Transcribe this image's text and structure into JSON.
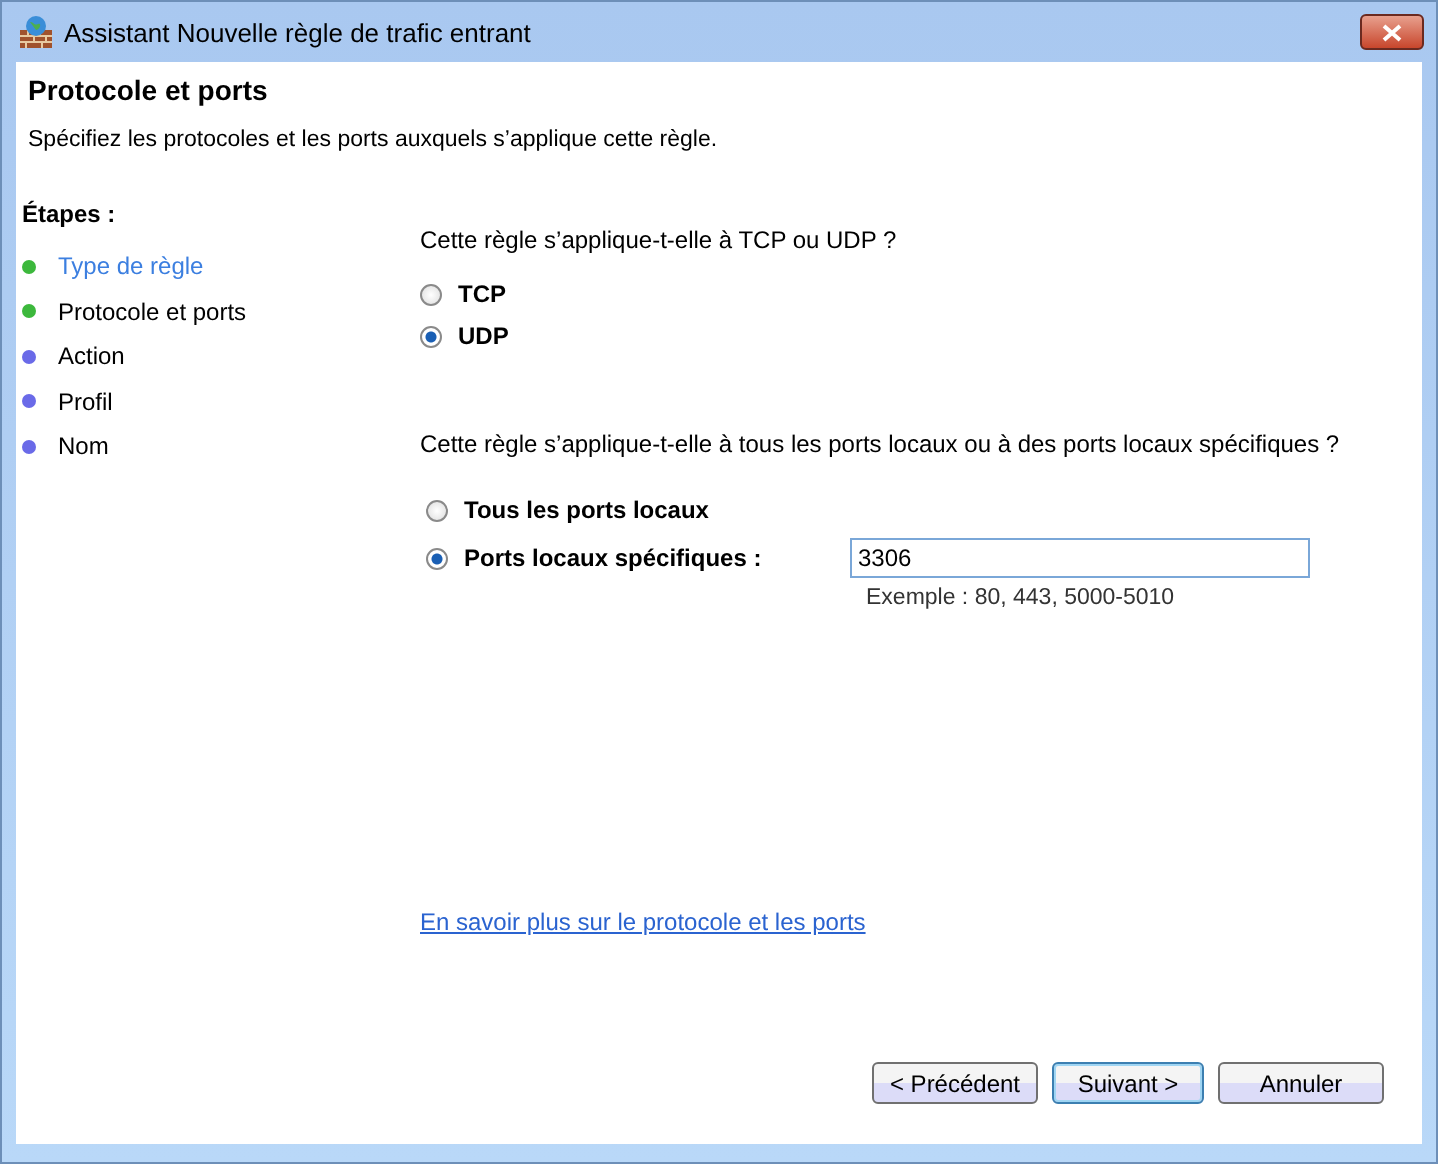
{
  "window": {
    "title": "Assistant Nouvelle règle de trafic entrant"
  },
  "header": {
    "title": "Protocole et ports",
    "subtitle": "Spécifiez les protocoles et les ports auxquels s’applique cette règle."
  },
  "steps": {
    "heading": "Étapes :",
    "items": [
      {
        "label": "Type de règle",
        "color": "#3cb83c",
        "link": true
      },
      {
        "label": "Protocole et ports",
        "color": "#3cb83c",
        "link": false
      },
      {
        "label": "Action",
        "color": "#6a6ae8",
        "link": false
      },
      {
        "label": "Profil",
        "color": "#6a6ae8",
        "link": false
      },
      {
        "label": "Nom",
        "color": "#6a6ae8",
        "link": false
      }
    ]
  },
  "protocol": {
    "question": "Cette règle s’applique-t-elle à TCP ou UDP ?",
    "options": [
      {
        "label": "TCP",
        "selected": false
      },
      {
        "label": "UDP",
        "selected": true
      }
    ]
  },
  "ports": {
    "question": "Cette règle s’applique-t-elle à tous les ports locaux ou à des ports locaux spécifiques ?",
    "options": [
      {
        "label": "Tous les ports locaux",
        "selected": false
      },
      {
        "label": "Ports locaux spécifiques :",
        "selected": true
      }
    ],
    "value": "3306",
    "example": "Exemple : 80, 443, 5000-5010"
  },
  "link": "En savoir plus sur le protocole et les ports",
  "buttons": [
    {
      "label": "< Précédent",
      "default": false
    },
    {
      "label": "Suivant >",
      "default": true
    },
    {
      "label": "Annuler",
      "default": false
    }
  ]
}
